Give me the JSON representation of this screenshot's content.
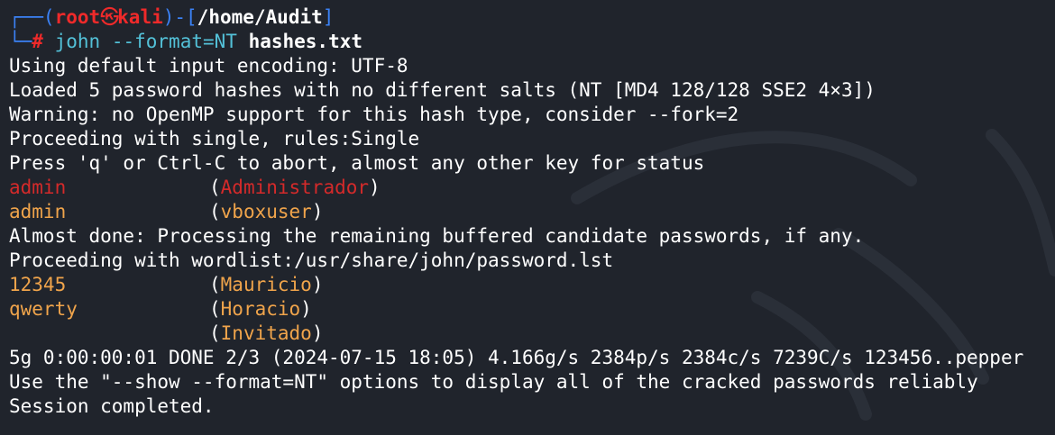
{
  "prompt": {
    "open": "┌──(",
    "user": "root",
    "at_icon": "kali-skull-icon",
    "host": "kali",
    "mid": ")-[",
    "path": "/home/Audit",
    "close": "]",
    "corner": "└─",
    "hash": "#"
  },
  "command": {
    "program": "john",
    "args": "--format=NT",
    "file": "hashes.txt"
  },
  "output": {
    "line1": "Using default input encoding: UTF-8",
    "line2": "Loaded 5 password hashes with no different salts (NT [MD4 128/128 SSE2 4×3])",
    "line3": "Warning: no OpenMP support for this hash type, consider --fork=2",
    "line4": "Proceeding with single, rules:Single",
    "line5": "Press 'q' or Ctrl-C to abort, almost any other key for status",
    "line8": "Almost done: Processing the remaining buffered candidate passwords, if any.",
    "line9": "Proceeding with wordlist:/usr/share/john/password.lst",
    "line13": "5g 0:00:00:01 DONE 2/3 (2024-07-15 18:05) 4.166g/s 2384p/s 2384c/s 7239C/s 123456..pepper",
    "line14": "Use the \"--show --format=NT\" options to display all of the cracked passwords reliably",
    "line15": "Session completed."
  },
  "cracked": [
    {
      "password": "admin",
      "user": "Administrador"
    },
    {
      "password": "admin",
      "user": "vboxuser"
    },
    {
      "password": "12345",
      "user": "Mauricio"
    },
    {
      "password": "qwerty",
      "user": "Horacio"
    },
    {
      "password": "",
      "user": "Invitado"
    }
  ],
  "colors": {
    "background": "#20242c",
    "prompt_blue": "#3b82f6",
    "prompt_red": "#ef2a2a",
    "command_cyan": "#53c1d8",
    "cracked_orange": "#f0a44b",
    "cracked_red": "#d42a2a"
  }
}
